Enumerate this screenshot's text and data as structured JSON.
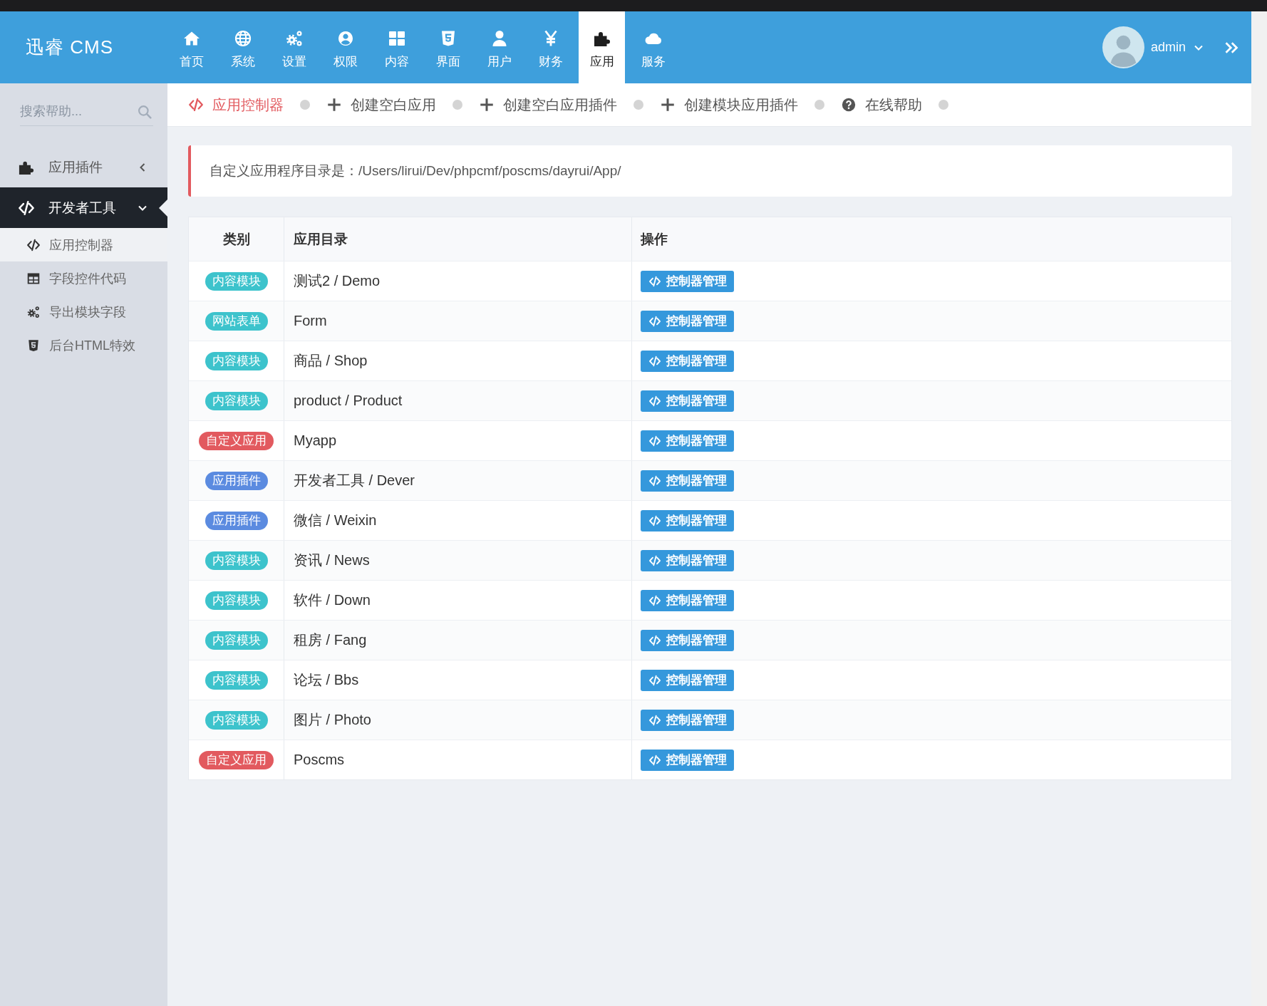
{
  "header": {
    "logo": "迅睿 CMS",
    "nav": [
      {
        "label": "首页",
        "selected": false
      },
      {
        "label": "系统",
        "selected": false
      },
      {
        "label": "设置",
        "selected": false
      },
      {
        "label": "权限",
        "selected": false
      },
      {
        "label": "内容",
        "selected": false
      },
      {
        "label": "界面",
        "selected": false
      },
      {
        "label": "用户",
        "selected": false
      },
      {
        "label": "财务",
        "selected": false
      },
      {
        "label": "应用",
        "selected": true
      },
      {
        "label": "服务",
        "selected": false
      }
    ],
    "user": {
      "name": "admin"
    }
  },
  "sidebar": {
    "search": {
      "placeholder": "搜索帮助..."
    },
    "menu": [
      {
        "label": "应用插件",
        "selected": false,
        "expanded": false
      },
      {
        "label": "开发者工具",
        "selected": true,
        "expanded": true,
        "children": [
          {
            "label": "应用控制器",
            "selected": true
          },
          {
            "label": "字段控件代码",
            "selected": false
          },
          {
            "label": "导出模块字段",
            "selected": false
          },
          {
            "label": "后台HTML特效",
            "selected": false
          }
        ]
      }
    ]
  },
  "toolbar": [
    {
      "kind": "controller",
      "label": "应用控制器",
      "selected": true
    },
    {
      "kind": "create",
      "label": "创建空白应用",
      "selected": false
    },
    {
      "kind": "create",
      "label": "创建空白应用插件",
      "selected": false
    },
    {
      "kind": "create",
      "label": "创建模块应用插件",
      "selected": false
    },
    {
      "kind": "help",
      "label": "在线帮助",
      "selected": false
    }
  ],
  "note": "自定义应用程序目录是：/Users/lirui/Dev/phpcmf/poscms/dayrui/App/",
  "table": {
    "columns": [
      "类别",
      "应用目录",
      "操作"
    ],
    "rows": [
      {
        "category": {
          "label": "内容模块",
          "color": "#3dc3cc"
        },
        "directory": "测试2 / Demo",
        "action": "控制器管理"
      },
      {
        "category": {
          "label": "网站表单",
          "color": "#3dc3cc"
        },
        "directory": "Form",
        "action": "控制器管理"
      },
      {
        "category": {
          "label": "内容模块",
          "color": "#3dc3cc"
        },
        "directory": "商品 / Shop",
        "action": "控制器管理"
      },
      {
        "category": {
          "label": "内容模块",
          "color": "#3dc3cc"
        },
        "directory": "product / Product",
        "action": "控制器管理"
      },
      {
        "category": {
          "label": "自定义应用",
          "color": "#e25a5f"
        },
        "directory": "Myapp",
        "action": "控制器管理"
      },
      {
        "category": {
          "label": "应用插件",
          "color": "#5b8be0"
        },
        "directory": "开发者工具 / Dever",
        "action": "控制器管理"
      },
      {
        "category": {
          "label": "应用插件",
          "color": "#5b8be0"
        },
        "directory": "微信 / Weixin",
        "action": "控制器管理"
      },
      {
        "category": {
          "label": "内容模块",
          "color": "#3dc3cc"
        },
        "directory": "资讯 / News",
        "action": "控制器管理"
      },
      {
        "category": {
          "label": "内容模块",
          "color": "#3dc3cc"
        },
        "directory": "软件 / Down",
        "action": "控制器管理"
      },
      {
        "category": {
          "label": "内容模块",
          "color": "#3dc3cc"
        },
        "directory": "租房 / Fang",
        "action": "控制器管理"
      },
      {
        "category": {
          "label": "内容模块",
          "color": "#3dc3cc"
        },
        "directory": "论坛 / Bbs",
        "action": "控制器管理"
      },
      {
        "category": {
          "label": "内容模块",
          "color": "#3dc3cc"
        },
        "directory": "图片 / Photo",
        "action": "控制器管理"
      },
      {
        "category": {
          "label": "自定义应用",
          "color": "#e25a5f"
        },
        "directory": "Poscms",
        "action": "控制器管理"
      }
    ]
  }
}
